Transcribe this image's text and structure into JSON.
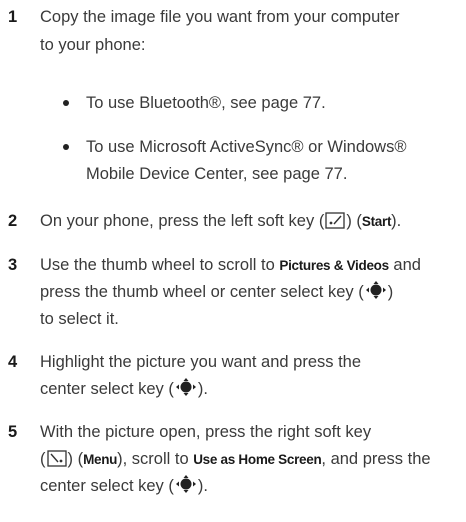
{
  "steps": [
    {
      "num": "1",
      "line1": "Copy the image file you want from your computer",
      "line2": "to your phone:"
    },
    {
      "num": "2",
      "text_a": "On your phone, press the left soft key (",
      "text_b": ") (",
      "start": "Start",
      "text_c": ")."
    },
    {
      "num": "3",
      "line1_a": "Use the thumb wheel to scroll to ",
      "pictures_videos": "Pictures & Videos",
      "line1_b": " and",
      "line2_a": "press the thumb wheel or center select key (",
      "line2_b": ")",
      "line3": "to select it."
    },
    {
      "num": "4",
      "line1": "Highlight the picture you want and press the",
      "line2_a": "center select key (",
      "line2_b": ")."
    },
    {
      "num": "5",
      "line1_a": "With the picture open, press the right soft key",
      "line2_a": "(",
      "line2_b": ") (",
      "menu": "Menu",
      "line2_c": "), scroll to ",
      "use_as_home": "Use as Home Screen",
      "line2_d": ", and press the",
      "line3_a": "center select key (",
      "line3_b": ")."
    }
  ],
  "bullets": [
    {
      "line1": "To use Bluetooth®, see page 77."
    },
    {
      "line1": "To use Microsoft ActiveSync® or Windows®",
      "line2": "Mobile Device Center, see page 77."
    }
  ],
  "icons": {
    "left_soft_key": "left-soft-key-icon",
    "right_soft_key": "right-soft-key-icon",
    "center_select": "center-select-key-icon"
  }
}
